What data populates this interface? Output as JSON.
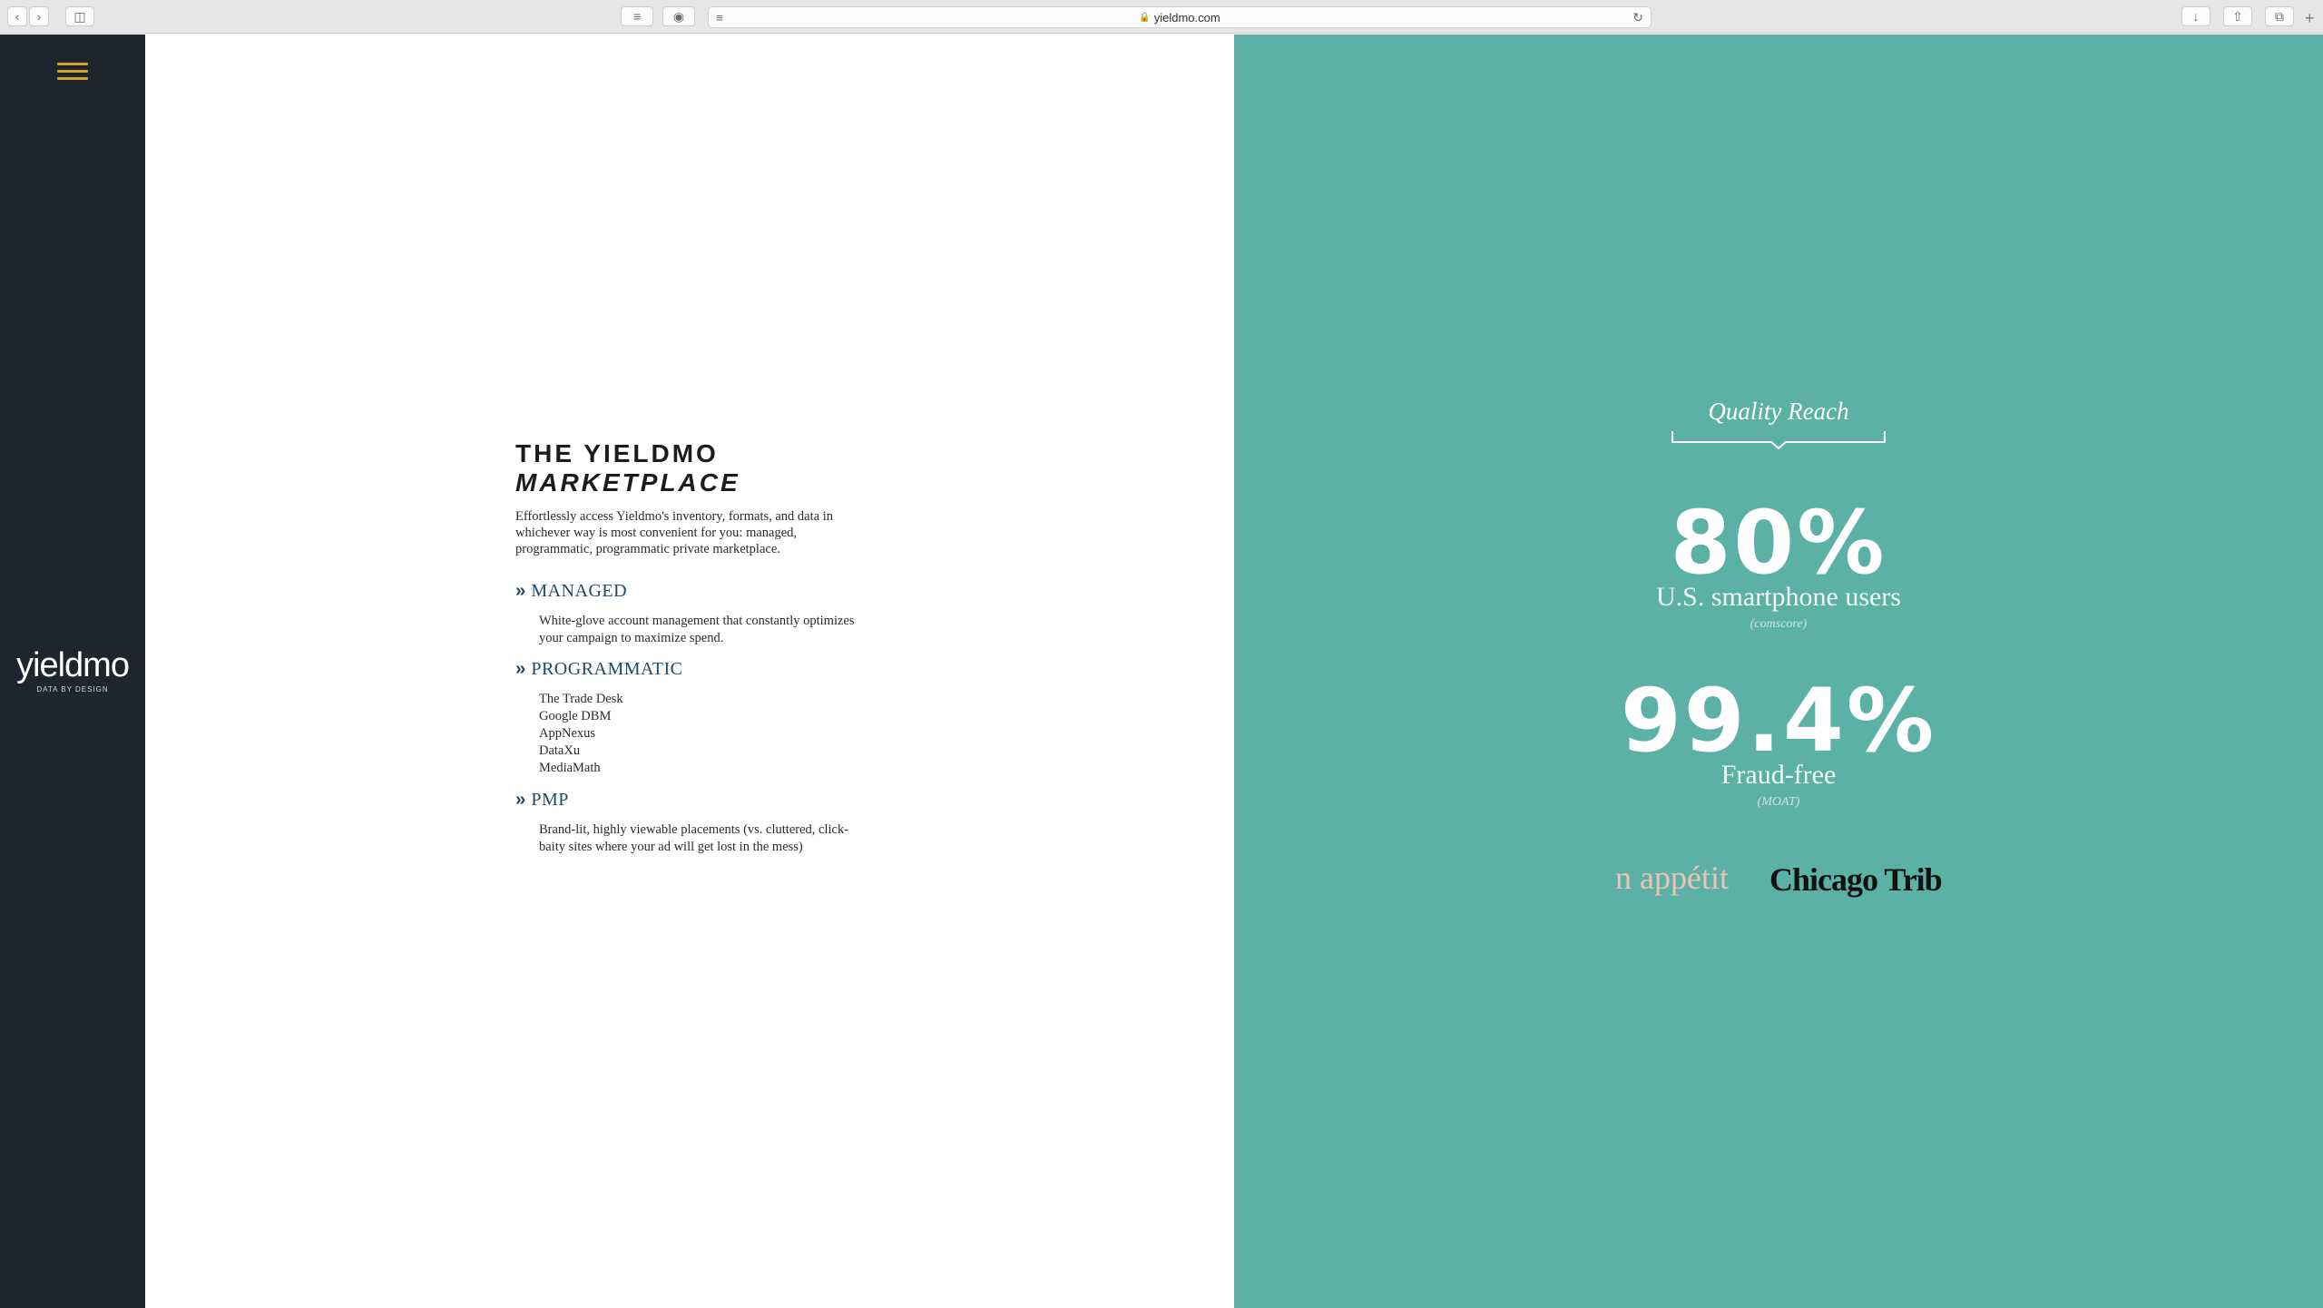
{
  "browser": {
    "url": "yieldmo.com"
  },
  "sidebar": {
    "logo_text": "yieldmo",
    "tagline": "DATA BY DESIGN"
  },
  "main": {
    "title_line1": "THE YIELDMO",
    "title_line2": "MARKETPLACE",
    "intro": "Effortlessly access Yieldmo's inventory, formats, and data in whichever way is most convenient for you: managed, programmatic, programmatic private marketplace.",
    "sections": [
      {
        "heading": "MANAGED",
        "body": "White-glove account management that constantly optimizes your campaign to maximize spend."
      },
      {
        "heading": "PROGRAMMATIC",
        "items": [
          "The Trade Desk",
          "Google DBM",
          "AppNexus",
          "DataXu",
          "MediaMath"
        ]
      },
      {
        "heading": "PMP",
        "body": "Brand-lit, highly viewable placements (vs. cluttered, click-baity sites where your ad will get lost in the mess)"
      }
    ]
  },
  "panel": {
    "heading": "Quality Reach",
    "stats": [
      {
        "value": "80%",
        "label": "U.S. smartphone users",
        "source": "(comscore)"
      },
      {
        "value": "99.4%",
        "label": "Fraud-free",
        "source": "(MOAT)"
      }
    ],
    "publishers": [
      "n appétit",
      "Chicago Trib"
    ]
  },
  "colors": {
    "sidebar_bg": "#1f252e",
    "accent": "#d4a22f",
    "panel_bg": "#5cb1a7",
    "heading_blue": "#1b4a6b"
  }
}
